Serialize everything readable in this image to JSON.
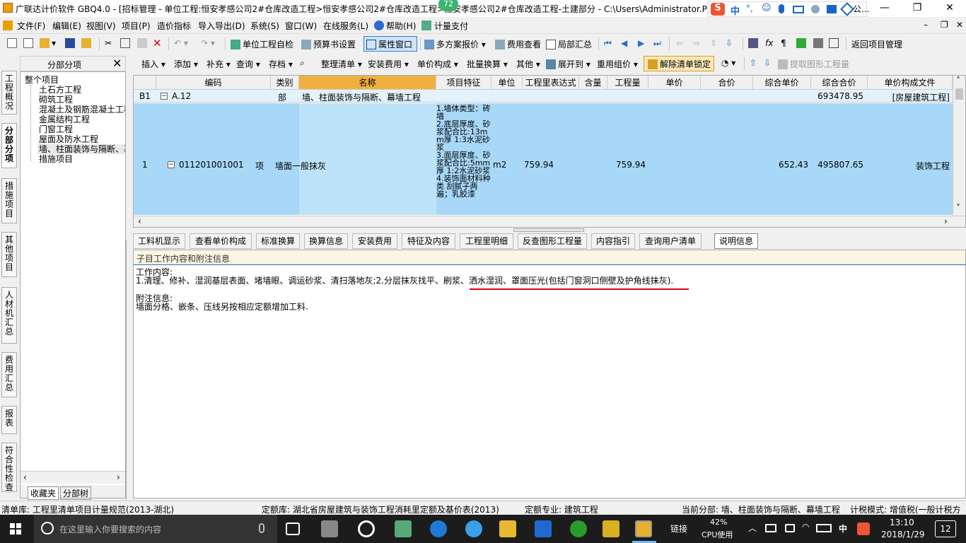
{
  "window": {
    "title": "广联达计价软件 GBQ4.0 - [招标管理 - 单位工程:恒安孝感公司2#仓库改造工程>恒安孝感公司2#仓库改造工程>恒安孝感公司2#仓库改造工程-土建部分 - C:\\Users\\Administrator.PC",
    "badge": "72",
    "tail": "公..."
  },
  "ime": {
    "label": "中",
    "items": [
      "°,",
      "☺"
    ]
  },
  "menu": [
    "文件(F)",
    "编辑(E)",
    "视图(V)",
    "项目(P)",
    "造价指标",
    "导入导出(D)",
    "系统(S)",
    "窗口(W)",
    "在线服务(L)",
    "帮助(H)",
    "计量支付"
  ],
  "toolbar1": {
    "check": "单位工程自检",
    "budget": "预算书设置",
    "prop": "属性窗口",
    "multi": "多方案报价",
    "fee": "费用查看",
    "local": "局部汇总",
    "back": "返回项目管理"
  },
  "toolbar2": [
    "插入",
    "添加",
    "补充",
    "查询",
    "存档",
    "整理清单",
    "安装费用",
    "单价构成",
    "批量换算",
    "其他",
    "展开到",
    "重用组价",
    "解除清单锁定",
    "提取图形工程量"
  ],
  "vtabs": [
    "工程概况",
    "分部分项",
    "措施项目",
    "其他项目",
    "人材机汇总",
    "费用汇总",
    "报表",
    "符合性检查"
  ],
  "tree": {
    "title": "分部分项",
    "root": "整个项目",
    "items": [
      "土石方工程",
      "砌筑工程",
      "混凝土及钢筋混凝土工程",
      "金属结构工程",
      "门窗工程",
      "屋面及防水工程",
      "墙、柱面装饰与隔断、幕",
      "措施项目"
    ],
    "tabs": [
      "收藏夹",
      "分部树"
    ]
  },
  "grid": {
    "headers": [
      "编码",
      "类别",
      "名称",
      "项目特征",
      "单位",
      "工程里表达式",
      "含量",
      "工程量",
      "单价",
      "合价",
      "综合单价",
      "综合合价",
      "单价构成文件"
    ],
    "row0": {
      "no": "B1",
      "code": "A.12",
      "type": "部",
      "name": "墙、柱面装饰与隔断、幕墙工程",
      "total": "693478.95",
      "file": "[房屋建筑工程]"
    },
    "row1": {
      "no": "1",
      "code": "011201001001",
      "type": "项",
      "name": "墙面一般抹灰",
      "feature": "1.墙体类型：砖墙\n2.底层厚度、砂浆配合比:13mm厚 1:3水泥砂浆\n3.面层厚度、砂浆配合比:5mm厚 1:2水泥砂浆\n4.装饰面材料种类 刮腻子两遍；乳胶漆",
      "unit": "m2",
      "expr": "759.94",
      "qty": "759.94",
      "uprice": "652.43",
      "total": "495807.65",
      "file": "装饰工程"
    }
  },
  "btabs": [
    "工料机显示",
    "查看单价构成",
    "标准换算",
    "换算信息",
    "安装费用",
    "特征及内容",
    "工程里明细",
    "反查图形工程量",
    "内容指引",
    "查询用户清单",
    "说明信息"
  ],
  "panel": {
    "title": "子目工作内容和附注信息",
    "l1": "工作内容:",
    "l2a": "1.清理、修补、湿润基层表面、堵墙眼、调运砂浆、清扫落地灰;2.分层抹灰找平、刷浆、",
    "l2b": "洒水湿润、罩面压光(包括门窗洞口侧壁及护角线抹灰).",
    "l3": "附注信息:",
    "l4": "墙面分格、嵌条、压线另按相应定额增加工料."
  },
  "status": {
    "s1": "清单库: 工程里清单项目计量规范(2013-湖北)",
    "s2": "定额库: 湖北省房屋建筑与装饰工程消耗里定额及基价表(2013)",
    "s3": "定额专业: 建筑工程",
    "s4": "当前分部: 墙、柱面装饰与隔断、幕墙工程",
    "s5": "计税模式: 增值税(一般计税方"
  },
  "taskbar": {
    "search": "在这里输入你要搜索的内容",
    "link": "链接",
    "cpu": "42%",
    "cpu_label": "CPU使用",
    "lang": "中",
    "time": "13:10",
    "date": "2018/1/29",
    "notif": "12"
  },
  "colors": {
    "selrow": "#a8d8f8",
    "namehdr": "#f0b040",
    "accent": "#0078d7"
  }
}
